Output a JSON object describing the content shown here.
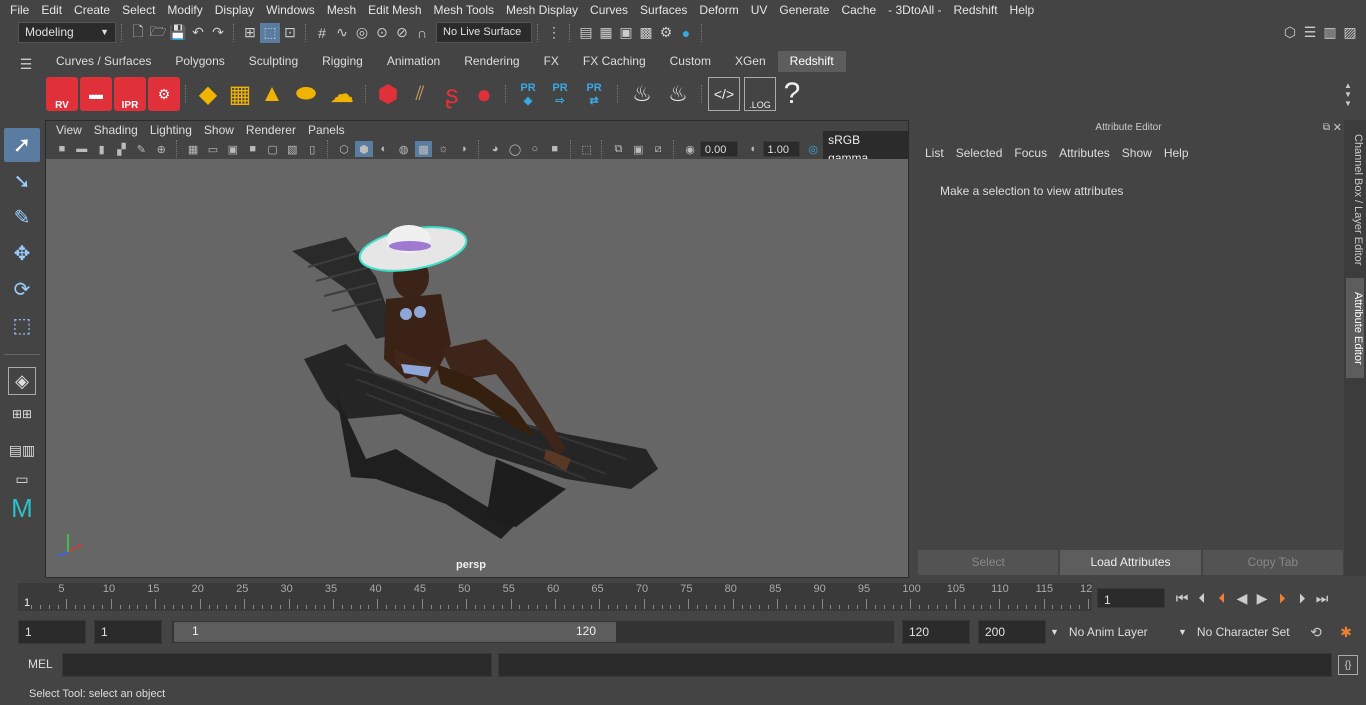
{
  "menubar": [
    "File",
    "Edit",
    "Create",
    "Select",
    "Modify",
    "Display",
    "Windows",
    "Mesh",
    "Edit Mesh",
    "Mesh Tools",
    "Mesh Display",
    "Curves",
    "Surfaces",
    "Deform",
    "UV",
    "Generate",
    "Cache",
    "- 3DtoAll -",
    "Redshift",
    "Help"
  ],
  "status": {
    "mode": "Modeling",
    "live_surface": "No Live Surface"
  },
  "shelf_tabs": [
    "Curves / Surfaces",
    "Polygons",
    "Sculpting",
    "Rigging",
    "Animation",
    "Rendering",
    "FX",
    "FX Caching",
    "Custom",
    "XGen",
    "Redshift"
  ],
  "shelf_active": "Redshift",
  "shelf_labels": {
    "rv": "RV",
    "ipr": "IPR",
    "pr": "PR",
    "log": ".LOG",
    "help": "?"
  },
  "viewport": {
    "menu": [
      "View",
      "Shading",
      "Lighting",
      "Show",
      "Renderer",
      "Panels"
    ],
    "exposure": "0.00",
    "gamma": "1.00",
    "color_space": "sRGB gamma",
    "camera": "persp"
  },
  "attribute_editor": {
    "title": "Attribute Editor",
    "menu": [
      "List",
      "Selected",
      "Focus",
      "Attributes",
      "Show",
      "Help"
    ],
    "message": "Make a selection to view attributes",
    "buttons": [
      "Select",
      "Load Attributes",
      "Copy Tab"
    ]
  },
  "side_tabs": [
    "Channel Box / Layer Editor",
    "Attribute Editor"
  ],
  "timeline": {
    "ticks": [
      "5",
      "10",
      "15",
      "20",
      "25",
      "30",
      "35",
      "40",
      "45",
      "50",
      "55",
      "60",
      "65",
      "70",
      "75",
      "80",
      "85",
      "90",
      "95",
      "100",
      "105",
      "110",
      "115",
      "12"
    ],
    "start_marker": "1",
    "current_frame": "1"
  },
  "range": {
    "start": "1",
    "playback_start": "1",
    "slider_start": "1",
    "slider_end": "120",
    "playback_end": "120",
    "end": "200",
    "anim_layer": "No Anim Layer",
    "character_set": "No Character Set"
  },
  "command": {
    "label": "MEL"
  },
  "help_line": "Select Tool: select an object",
  "colors": {
    "bg": "#444444",
    "field": "#2b2b2b",
    "viewport": "#666666",
    "accent": "#5a7ca0",
    "redshift_red": "#e0303a",
    "pr_blue": "#3aa7e0"
  }
}
